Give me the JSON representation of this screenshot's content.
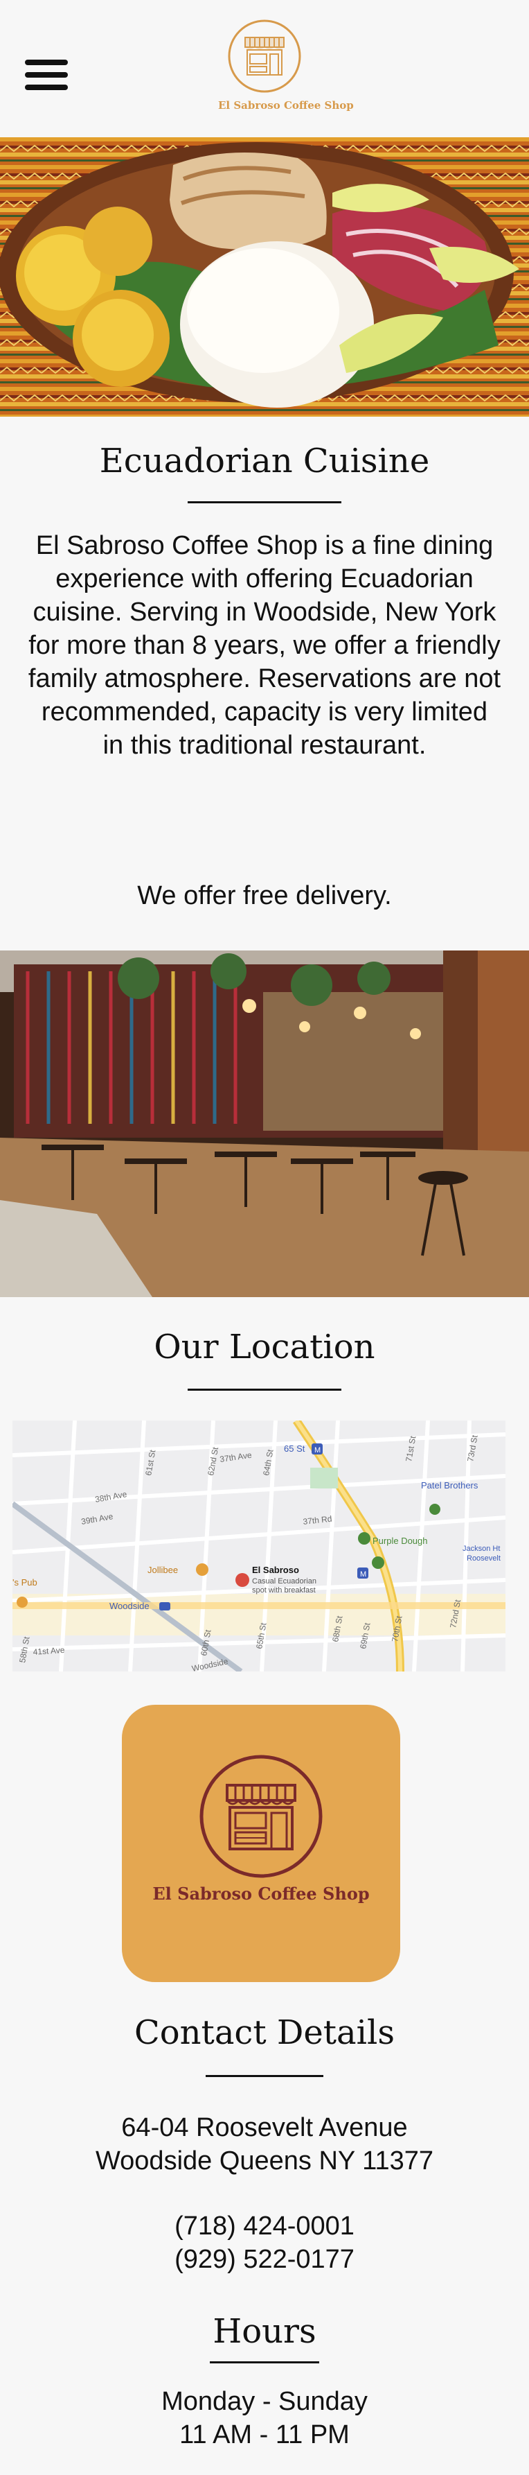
{
  "header": {
    "brand": "El Sabroso Coffee Shop",
    "menu_icon": "hamburger-menu-icon"
  },
  "about": {
    "title": "Ecuadorian Cuisine",
    "description": "El Sabroso Coffee Shop is a fine dining experience with offering Ecuadorian cuisine. Serving in Woodside, New York for more than 8 years, we offer a friendly  family atmosphere. Reservations are not recommended, capacity is very limited in this traditional restaurant.",
    "delivery": "We offer free delivery."
  },
  "location": {
    "title": "Our Location",
    "map": {
      "streets": [
        "37th Ave",
        "65 St",
        "38th Ave",
        "39th Ave",
        "37th Rd",
        "41st Ave",
        "61st St",
        "62nd St",
        "64th St",
        "69th St",
        "71st St",
        "72nd St",
        "73rd St",
        "70th St",
        "68th St",
        "60th St",
        "58th St",
        "65th St",
        "Woodside",
        "Woodside"
      ],
      "places": [
        {
          "name": "Patel Brothers"
        },
        {
          "name": "Purple Dough"
        },
        {
          "name": "Jackson Ht Roosevelt"
        },
        {
          "name": "Jollibee"
        },
        {
          "name": "El Sabroso",
          "subtitle": "Casual Ecuadorian spot with breakfast"
        },
        {
          "name": "Woodside"
        },
        {
          "name": "'s Pub"
        }
      ],
      "transit_badges": [
        "M",
        "M"
      ]
    }
  },
  "logo_card": {
    "name": "El Sabroso Coffee Shop"
  },
  "contact": {
    "title": "Contact Details",
    "address_line1": "64-04 Roosevelt Avenue",
    "address_line2": "Woodside Queens NY 11377",
    "phone1": "(718) 424-0001",
    "phone2": "(929) 522-0177"
  },
  "hours": {
    "title": "Hours",
    "days": "Monday - Sunday",
    "time": "11 AM - 11 PM"
  },
  "colors": {
    "accent": "#e4a751",
    "brand_dark": "#7b2a2a",
    "logo_orange": "#d79a4b",
    "background": "#f7f7f7"
  }
}
